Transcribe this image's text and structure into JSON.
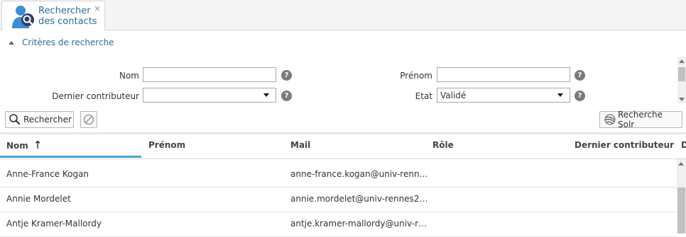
{
  "tab": {
    "title_line1": "Rechercher",
    "title_line2": "des contacts",
    "close_glyph": "×",
    "icon": "user-search-icon"
  },
  "criteria": {
    "label": "Critères de recherche",
    "expanded": true
  },
  "form": {
    "nom_label": "Nom",
    "nom_value": "",
    "prenom_label": "Prénom",
    "prenom_value": "",
    "dernier_contributeur_label": "Dernier contributeur",
    "dernier_contributeur_value": "",
    "etat_label": "Etat",
    "etat_value": "Validé",
    "help_glyph": "?"
  },
  "buttons": {
    "search_label": "Rechercher",
    "solr_label": "Recherche Solr"
  },
  "grid": {
    "columns": [
      {
        "label": "Nom",
        "sorted": "ascending"
      },
      {
        "label": "Prénom"
      },
      {
        "label": "Mail"
      },
      {
        "label": "Rôle"
      },
      {
        "label": "Dernier contributeur"
      },
      {
        "label": "D"
      }
    ],
    "sort_arrow": "↑",
    "rows": [
      {
        "nom": "Anne-France Kogan",
        "prenom": "",
        "mail": "anne-france.kogan@univ-renn…",
        "role": "",
        "contributeur": ""
      },
      {
        "nom": "Annie Mordelet",
        "prenom": "",
        "mail": "annie.mordelet@univ-rennes2…",
        "role": "",
        "contributeur": ""
      },
      {
        "nom": "Antje Kramer-Mallordy",
        "prenom": "",
        "mail": "antje.kramer-mallordy@univ-r…",
        "role": "",
        "contributeur": ""
      }
    ]
  },
  "colors": {
    "accent": "#2a6f9c",
    "sort_indicator": "#4aa3d6",
    "icon_blue": "#3b8fd0",
    "help_bg": "#7a7a7a"
  }
}
